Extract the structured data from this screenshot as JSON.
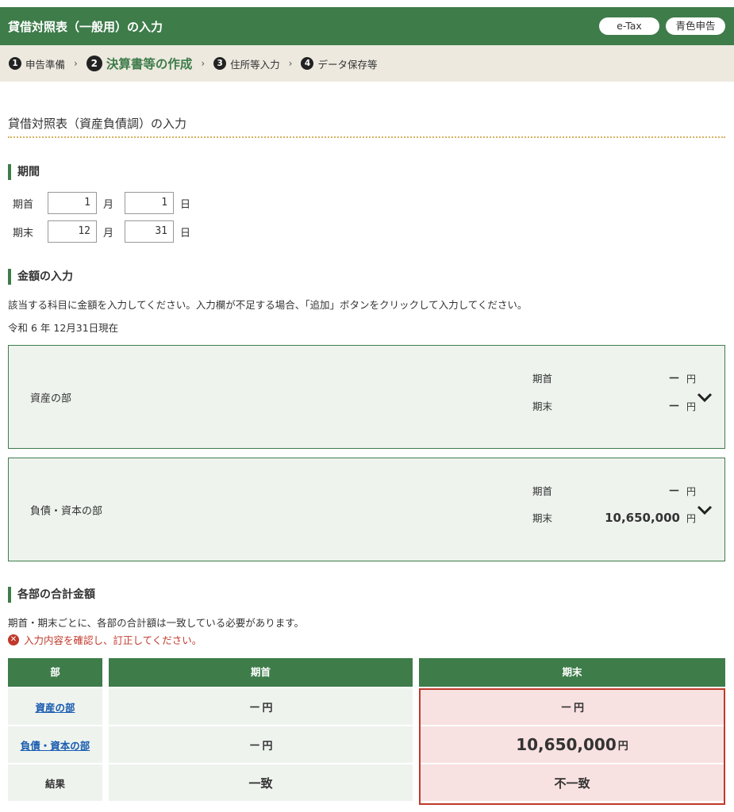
{
  "header": {
    "title": "貸借対照表（一般用）の入力",
    "badges": [
      "e-Tax",
      "青色申告"
    ]
  },
  "steps": [
    {
      "num": "1",
      "label": "申告準備"
    },
    {
      "num": "2",
      "label": "決算書等の作成"
    },
    {
      "num": "3",
      "label": "住所等入力"
    },
    {
      "num": "4",
      "label": "データ保存等"
    }
  ],
  "step_separator": "›",
  "page_title": "貸借対照表（資産負債調）の入力",
  "period": {
    "heading": "期間",
    "start_label": "期首",
    "end_label": "期末",
    "start_month": "1",
    "start_day": "1",
    "end_month": "12",
    "end_day": "31",
    "month_unit": "月",
    "day_unit": "日"
  },
  "amount": {
    "heading": "金額の入力",
    "instruction": "該当する科目に金額を入力してください。入力欄が不足する場合、「追加」ボタンをクリックして入力してください。",
    "as_of": "令和 6 年 12月31日現在"
  },
  "sections": [
    {
      "name": "資産の部",
      "start_label": "期首",
      "start_value": "－",
      "end_label": "期末",
      "end_value": "－",
      "unit": "円"
    },
    {
      "name": "負債・資本の部",
      "start_label": "期首",
      "start_value": "－",
      "end_label": "期末",
      "end_value": "10,650,000",
      "unit": "円"
    }
  ],
  "totals": {
    "heading": "各部の合計金額",
    "note": "期首・期末ごとに、各部の合計額は一致している必要があります。",
    "error": "入力内容を確認し、訂正してください。",
    "columns": [
      "部",
      "期首",
      "期末"
    ],
    "rows": [
      {
        "name": "資産の部",
        "start": "－",
        "end": "－"
      },
      {
        "name": "負債・資本の部",
        "start": "－",
        "end": "10,650,000"
      }
    ],
    "unit": "円",
    "result_label": "結果",
    "result_start": "一致",
    "result_end": "不一致"
  },
  "colors": {
    "brand": "#3e7c4a",
    "error": "#c0392b",
    "accent_line": "#d7b163"
  }
}
